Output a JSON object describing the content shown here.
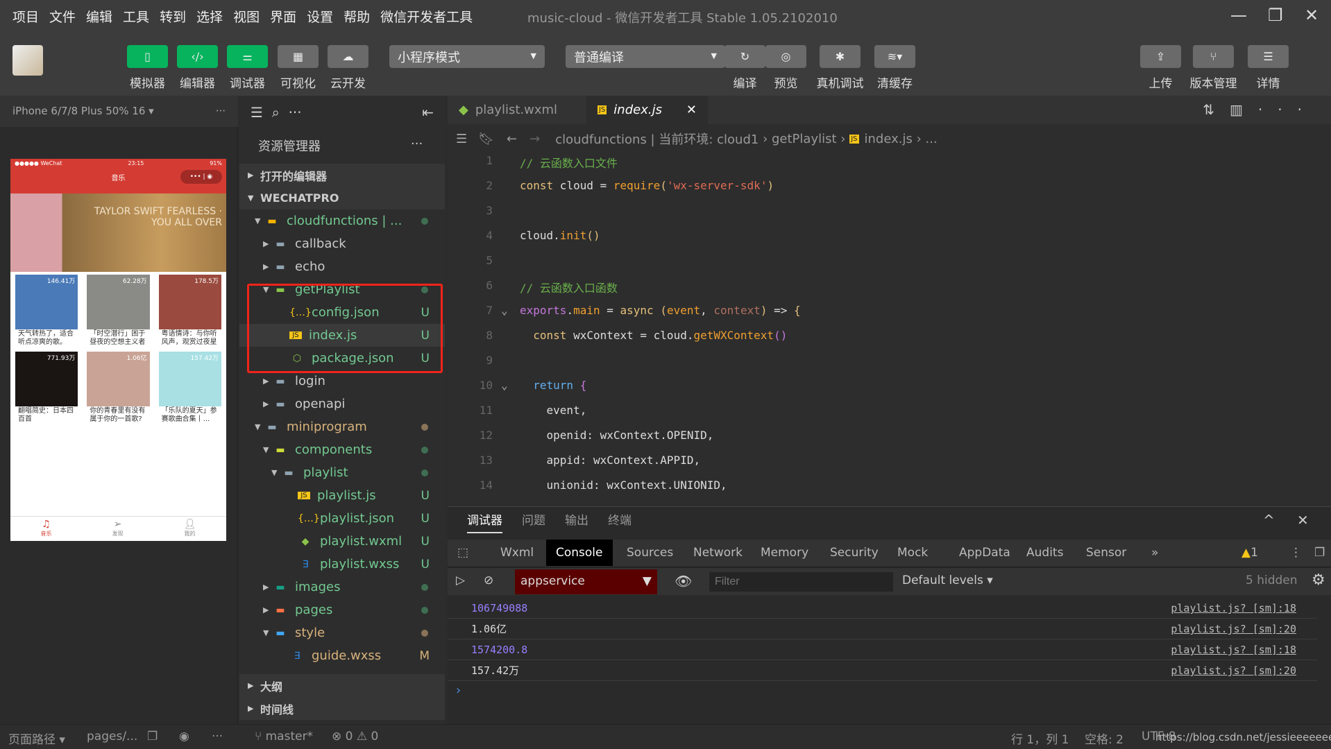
{
  "menu": [
    "项目",
    "文件",
    "编辑",
    "工具",
    "转到",
    "选择",
    "视图",
    "界面",
    "设置",
    "帮助",
    "微信开发者工具"
  ],
  "window_title": "music-cloud - 微信开发者工具 Stable 1.05.2102010",
  "toolbar": {
    "left": [
      {
        "label": "模拟器",
        "icon": "phone-icon"
      },
      {
        "label": "编辑器",
        "icon": "code-icon"
      },
      {
        "label": "调试器",
        "icon": "debug-sliders-icon"
      },
      {
        "label": "可视化",
        "icon": "layout-icon"
      },
      {
        "label": "云开发",
        "icon": "cloud-icon"
      }
    ],
    "mode_select": "小程序模式",
    "compile_select": "普通编译",
    "mid": [
      {
        "label": "编译",
        "icon": "refresh-icon"
      },
      {
        "label": "预览",
        "icon": "eye-icon"
      },
      {
        "label": "真机调试",
        "icon": "bug-icon"
      },
      {
        "label": "清缓存",
        "icon": "layers-icon"
      }
    ],
    "right": [
      {
        "label": "上传",
        "icon": "upload-icon"
      },
      {
        "label": "版本管理",
        "icon": "branch-icon"
      },
      {
        "label": "详情",
        "icon": "menu-icon"
      }
    ],
    "accent": "#07b35d"
  },
  "simulator": {
    "device": "iPhone 6/7/8 Plus 50% 16 ▾",
    "status": {
      "carrier": "●●●●● WeChat",
      "time": "23:15",
      "battery": "91%"
    },
    "nav_title": "音乐",
    "banner_text": "TAYLOR SWIFT FEARLESS · YOU ALL OVER",
    "playlists": [
      {
        "count": "146.41万",
        "title": "天气转热了，适合听点凉爽的歌。",
        "color": "#4a7ab8"
      },
      {
        "count": "62.28万",
        "title": "「时空潜行」困于昼夜的空想主义者",
        "color": "#8a8a86"
      },
      {
        "count": "178.5万",
        "title": "粤语情诗：与你听风声，观赏过夜星",
        "color": "#9a4a3e"
      },
      {
        "count": "771.93万",
        "title": "翻唱简史：日本四百首",
        "color": "#1a1412"
      },
      {
        "count": "1.06亿",
        "title": "你的青春里有没有属于你的一首歌?",
        "color": "#c9a496"
      },
      {
        "count": "157.42万",
        "title": "「乐队的夏天」参赛歌曲合集丨...",
        "color": "#a8e0e4"
      }
    ],
    "tabbar": [
      "音乐",
      "发现",
      "我的"
    ],
    "brand_red": "#d43c33"
  },
  "explorer": {
    "title": "资源管理器",
    "sections": {
      "open_editors": "打开的编辑器",
      "project": "WECHATPRO",
      "outline": "大纲",
      "timeline": "时间线"
    },
    "tree": [
      {
        "name": "cloudfunctions | ...",
        "depth": 0,
        "type": "folder-cloud",
        "open": true,
        "status": "dot"
      },
      {
        "name": "callback",
        "depth": 1,
        "type": "folder",
        "open": false
      },
      {
        "name": "echo",
        "depth": 1,
        "type": "folder",
        "open": false
      },
      {
        "name": "getPlaylist",
        "depth": 1,
        "type": "folder-green",
        "open": true,
        "status": "dot"
      },
      {
        "name": "config.json",
        "depth": 2,
        "type": "json",
        "status": "U"
      },
      {
        "name": "index.js",
        "depth": 2,
        "type": "js",
        "status": "U",
        "selected": true
      },
      {
        "name": "package.json",
        "depth": 2,
        "type": "node",
        "status": "U"
      },
      {
        "name": "login",
        "depth": 1,
        "type": "folder",
        "open": false
      },
      {
        "name": "openapi",
        "depth": 1,
        "type": "folder",
        "open": false
      },
      {
        "name": "miniprogram",
        "depth": 0,
        "type": "folder",
        "open": true,
        "status": "dot-brown"
      },
      {
        "name": "components",
        "depth": 1,
        "type": "folder-yellow",
        "open": true,
        "status": "dot"
      },
      {
        "name": "playlist",
        "depth": 2,
        "type": "folder",
        "open": true,
        "status": "dot"
      },
      {
        "name": "playlist.js",
        "depth": 3,
        "type": "js",
        "status": "U"
      },
      {
        "name": "playlist.json",
        "depth": 3,
        "type": "json",
        "status": "U"
      },
      {
        "name": "playlist.wxml",
        "depth": 3,
        "type": "wxml",
        "status": "U"
      },
      {
        "name": "playlist.wxss",
        "depth": 3,
        "type": "css",
        "status": "U"
      },
      {
        "name": "images",
        "depth": 1,
        "type": "folder-teal",
        "open": false,
        "status": "dot"
      },
      {
        "name": "pages",
        "depth": 1,
        "type": "folder-orange",
        "open": false,
        "status": "dot"
      },
      {
        "name": "style",
        "depth": 1,
        "type": "folder-blue",
        "open": true,
        "status": "dot-brown"
      },
      {
        "name": "guide.wxss",
        "depth": 2,
        "type": "css",
        "status": "M"
      }
    ]
  },
  "editor": {
    "tabs": [
      {
        "label": "playlist.wxml",
        "active": false
      },
      {
        "label": "index.js",
        "active": true
      }
    ],
    "breadcrumb": [
      "cloudfunctions | 当前环境: cloud1",
      "getPlaylist",
      "index.js",
      "..."
    ],
    "lines": [
      [
        [
          "cm",
          "// 云函数入口文件"
        ]
      ],
      [
        [
          "kw",
          "const"
        ],
        [
          "id",
          " cloud = "
        ],
        [
          "fn",
          "require"
        ],
        [
          "kw",
          "("
        ],
        [
          "st",
          "'wx-server-sdk'"
        ],
        [
          "kw",
          ")"
        ]
      ],
      [],
      [
        [
          "id",
          "cloud."
        ],
        [
          "fn",
          "init"
        ],
        [
          "kw",
          "()"
        ]
      ],
      [],
      [
        [
          "cm",
          "// 云函数入口函数"
        ]
      ],
      [
        [
          "pu",
          "exports"
        ],
        [
          "id",
          "."
        ],
        [
          "fn",
          "main"
        ],
        [
          "id",
          " = "
        ],
        [
          "kw",
          "async"
        ],
        [
          "id",
          " "
        ],
        [
          "kw",
          "("
        ],
        [
          "fn",
          "event"
        ],
        [
          "id",
          ", "
        ],
        [
          "pa",
          "context"
        ],
        [
          "kw",
          ")"
        ],
        [
          "id",
          " => "
        ],
        [
          "kw",
          "{"
        ]
      ],
      [
        [
          "id",
          "  "
        ],
        [
          "kw",
          "const"
        ],
        [
          "id",
          " wxContext = cloud."
        ],
        [
          "fn",
          "getWXContext"
        ],
        [
          "pu",
          "()"
        ]
      ],
      [],
      [
        [
          "id",
          "  "
        ],
        [
          "bl",
          "return"
        ],
        [
          "id",
          " "
        ],
        [
          "pu",
          "{"
        ]
      ],
      [
        [
          "id",
          "    event,"
        ]
      ],
      [
        [
          "id",
          "    openid: wxContext.OPENID,"
        ]
      ],
      [
        [
          "id",
          "    appid: wxContext.APPID,"
        ]
      ],
      [
        [
          "id",
          "    unionid: wxContext.UNIONID,"
        ]
      ]
    ]
  },
  "panel": {
    "tabs": [
      "调试器",
      "问题",
      "输出",
      "终端"
    ],
    "devtools_tabs": [
      "Wxml",
      "Console",
      "Sources",
      "Network",
      "Memory",
      "Security",
      "Mock",
      "AppData",
      "Audits",
      "Sensor",
      "»"
    ],
    "warnings": "1",
    "context": "appservice",
    "filter_placeholder": "Filter",
    "levels": "Default levels ▾",
    "hidden": "5 hidden",
    "logs": [
      {
        "value": "106749088",
        "type": "number",
        "source": "playlist.js? [sm]:18"
      },
      {
        "value": "1.06亿",
        "type": "string",
        "source": "playlist.js? [sm]:20"
      },
      {
        "value": "1574200.8",
        "type": "number",
        "source": "playlist.js? [sm]:18"
      },
      {
        "value": "157.42万",
        "type": "string",
        "source": "playlist.js? [sm]:20"
      }
    ]
  },
  "status": {
    "page_path": "页面路径 ▾",
    "page": "pages/...",
    "branch": "master*",
    "errors": "0",
    "warnings": "0",
    "position": "行 1，列 1",
    "spaces": "空格: 2",
    "encoding": "UTF-8",
    "watermark": "https://blog.csdn.net/jessieeeeeee"
  }
}
